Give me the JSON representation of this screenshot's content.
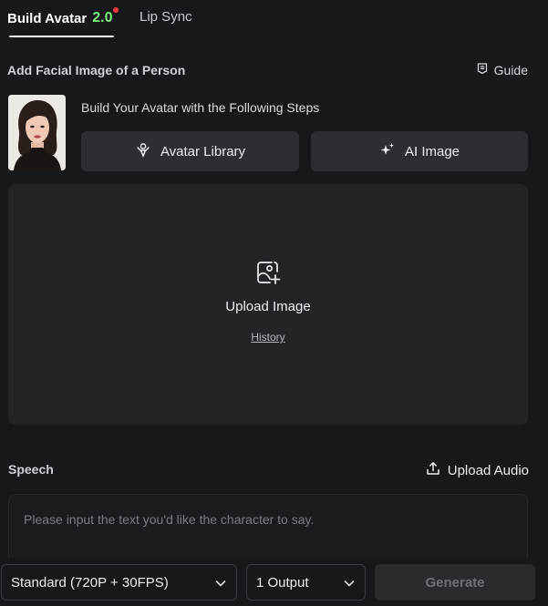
{
  "tabs": {
    "active_label": "Build Avatar",
    "active_version": "2.0",
    "second_label": "Lip Sync"
  },
  "facial": {
    "title": "Add Facial Image of a Person",
    "guide_label": "Guide",
    "steps_text": "Build Your Avatar with the Following Steps",
    "avatar_library_label": "Avatar Library",
    "ai_image_label": "AI Image"
  },
  "upload": {
    "label": "Upload Image",
    "history_label": "History"
  },
  "speech": {
    "title": "Speech",
    "upload_audio_label": "Upload Audio",
    "placeholder": "Please input the text you'd like the character to say.",
    "value": ""
  },
  "footer": {
    "quality_value": "Standard (720P + 30FPS)",
    "output_value": "1 Output",
    "generate_label": "Generate"
  },
  "colors": {
    "accent_green": "#7df07a",
    "notification_dot": "#ff3b3b",
    "background": "#17181b",
    "button_bg": "#2d2e33"
  },
  "icons": [
    "guide-icon",
    "avatar-library-icon",
    "ai-sparkle-icon",
    "upload-image-icon",
    "upload-audio-icon",
    "chevron-down-icon"
  ]
}
